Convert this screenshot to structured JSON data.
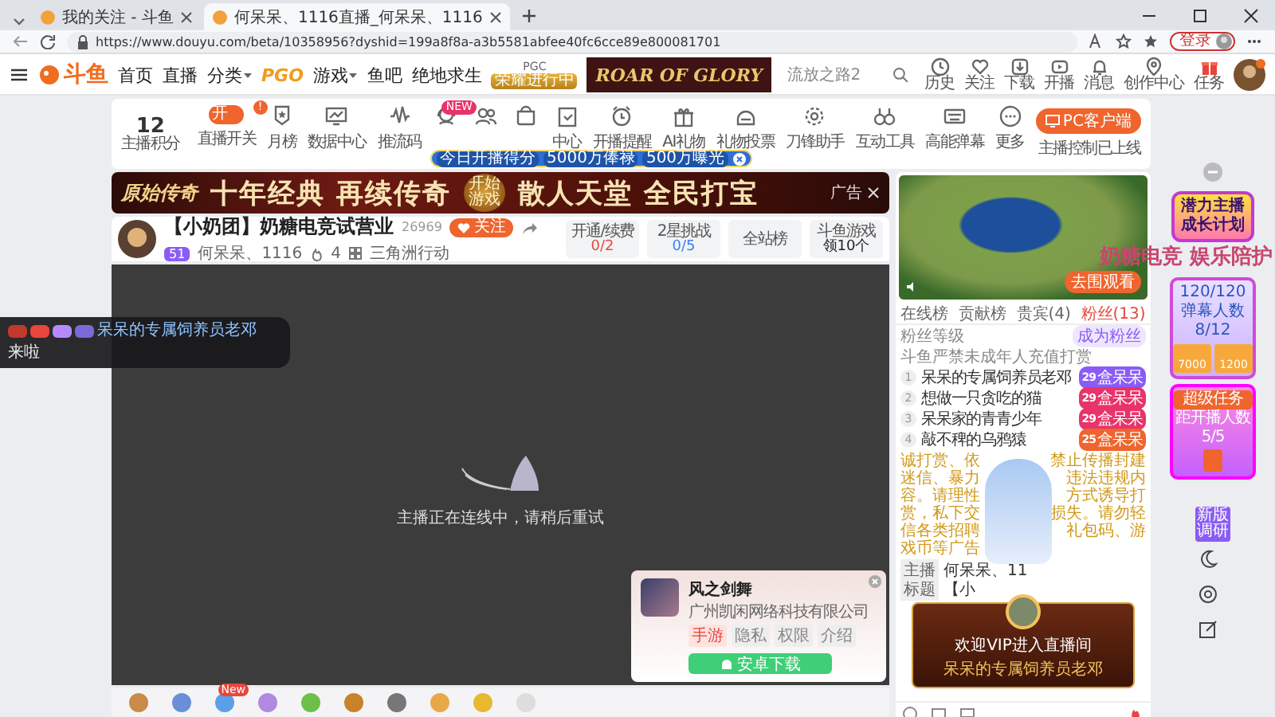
{
  "browser": {
    "tabs": [
      {
        "title": "我的关注 - 斗鱼",
        "selected": false
      },
      {
        "title": "何呆呆、1116直播_何呆呆、1116",
        "selected": true
      }
    ],
    "url": "https://www.douyu.com/beta/10358956?dyshid=199a8f8a-a3b5581abfee40fc6cce89e800081701",
    "login": "登录"
  },
  "site": {
    "logo": "斗鱼",
    "nav": [
      {
        "label": "首页",
        "kind": "link",
        "has_menu": false
      },
      {
        "label": "直播",
        "kind": "link",
        "has_menu": false
      },
      {
        "label": "分类",
        "kind": "link",
        "has_menu": true
      },
      {
        "label": "PGO",
        "kind": "logo"
      },
      {
        "label": "游戏",
        "kind": "link",
        "has_menu": true
      },
      {
        "label": "鱼吧",
        "kind": "link",
        "has_menu": false
      },
      {
        "label": "绝地求生",
        "kind": "link",
        "has_menu": false
      },
      {
        "label": "PGC",
        "badge": "荣耀进行中",
        "kind": "badge"
      }
    ],
    "ad": "ROAR OF GLORY",
    "search": {
      "placeholder": "流放之路2"
    },
    "user_menu": [
      "历史",
      "关注",
      "下载",
      "开播",
      "消息",
      "创作中心",
      "任务"
    ]
  },
  "toolbar": {
    "score": {
      "value": "12",
      "label": "主播积分"
    },
    "items": [
      {
        "label": "直播开关",
        "kind": "toggle",
        "toggle_text": "开",
        "on": true,
        "badge": "!"
      },
      {
        "label": "月榜",
        "kind": "icon"
      },
      {
        "label": "数据中心",
        "kind": "icon"
      },
      {
        "label": "推流码",
        "kind": "icon"
      },
      {
        "kind": "icon",
        "badge": "NEW"
      },
      {
        "kind": "icon"
      },
      {
        "kind": "icon"
      },
      {
        "label": "中心",
        "kind": "icon"
      },
      {
        "label": "开播提醒",
        "kind": "icon"
      },
      {
        "label": "AI礼物",
        "kind": "icon"
      },
      {
        "label": "礼物投票",
        "kind": "icon"
      },
      {
        "label": "刀锋助手",
        "kind": "icon"
      },
      {
        "label": "互动工具",
        "kind": "icon"
      },
      {
        "label": "高能弹幕",
        "kind": "icon"
      },
      {
        "label": "更多",
        "kind": "icon"
      }
    ],
    "tooltip": [
      "今日开播得分",
      "5000万俸禄",
      "500万曝光"
    ],
    "pc_client": "PC客户端",
    "note": "主播控制已上线"
  },
  "ad_banner": {
    "brand": "原始传奇",
    "slogan_1": "十年经典 再续传奇",
    "button": "开始游戏",
    "slogan_2": "散人天堂 全民打宝",
    "tag": "广告"
  },
  "stream": {
    "title": "【小奶团】奶糖电竞试营业",
    "followers": "26969",
    "follow": "关注",
    "level": "51",
    "anchor": "何呆呆、1116",
    "heat": "4",
    "category": "三角洲行动",
    "boxes": [
      {
        "label": "开通/续费",
        "value": "0/2",
        "color": "#e8453c"
      },
      {
        "label": "2星挑战",
        "value": "0/5",
        "color": "#3b7ff0"
      },
      {
        "label": "全站榜"
      },
      {
        "label": "斗鱼游戏",
        "value": "领10个",
        "color": "#222222"
      }
    ]
  },
  "video": {
    "status": "主播正在连线中，请稍后重试"
  },
  "game_card": {
    "name": "风之剑舞",
    "company": "广州凯闲网络科技有限公司",
    "tags": [
      {
        "label": "手游",
        "kind": "genre"
      },
      {
        "label": "隐私",
        "kind": "link"
      },
      {
        "label": "权限",
        "kind": "link"
      },
      {
        "label": "介绍",
        "kind": "link"
      }
    ],
    "download": "安卓下载"
  },
  "gifts": [
    {
      "new": false
    },
    {
      "new": false
    },
    {
      "new": true
    },
    {
      "new": false
    },
    {
      "new": false
    },
    {
      "new": false
    },
    {
      "new": false
    },
    {
      "new": false
    },
    {
      "new": false
    },
    {
      "new": false
    }
  ],
  "gift_new_label": "New",
  "chat_overlay": {
    "user": "呆呆的专属饲养员老邓",
    "message": "来啦"
  },
  "side": {
    "preview_button": "去围观看",
    "tabs": [
      {
        "label": "在线榜",
        "selected": false
      },
      {
        "label": "贡献榜",
        "selected": false
      },
      {
        "label": "贵宾(4)",
        "selected": false
      },
      {
        "label": "粉丝(13)",
        "selected": true
      }
    ],
    "fan_level": "粉丝等级",
    "join": "成为粉丝",
    "warning": "斗鱼严禁未成年人充值打赏",
    "fans": [
      {
        "rank": "1",
        "name": "呆呆的专属饲养员老邓",
        "level": "29",
        "badge": "盒呆呆",
        "color": "#8a5cf5"
      },
      {
        "rank": "2",
        "name": "想做一只贪吃的猫",
        "level": "29",
        "badge": "盒呆呆",
        "color": "#e8336b"
      },
      {
        "rank": "3",
        "name": "呆呆家的青青少年",
        "level": "29",
        "badge": "盒呆呆",
        "color": "#e8336b"
      },
      {
        "rank": "4",
        "name": "敲不稗的乌鸦猿",
        "level": "25",
        "badge": "盒呆呆",
        "color": "#f0642d"
      }
    ],
    "notice": [
      {
        "left": "诚打赏、依",
        "right": "禁止传播封建"
      },
      {
        "left": "迷信、暴力",
        "right": "违法违规内"
      },
      {
        "left": "容。请理性",
        "right": "方式诱导打"
      },
      {
        "left": "赏，私下交",
        "right": "损失。请勿轻"
      },
      {
        "left": "信各类招聘",
        "right": "礼包码、游"
      },
      {
        "left": "戏币等广告"
      }
    ],
    "info": [
      {
        "label": "主播",
        "value": "何呆呆、11"
      },
      {
        "label": "标题",
        "value": "【小"
      }
    ],
    "vip": {
      "title": "欢迎VIP进入直播间",
      "user": "呆呆的专属饲养员老邓"
    }
  },
  "promo": {
    "title": "潜力主播成长计划",
    "progress": "120/120",
    "metric": "弹幕人数",
    "count": "8/12",
    "rewards": [
      "7000",
      "1200"
    ],
    "task": "超级任务",
    "task_metric": "距开播人数",
    "task_count": "5/5",
    "survey": "新版调研"
  },
  "overlay_text": "奶糖电竞 娱乐陪护"
}
